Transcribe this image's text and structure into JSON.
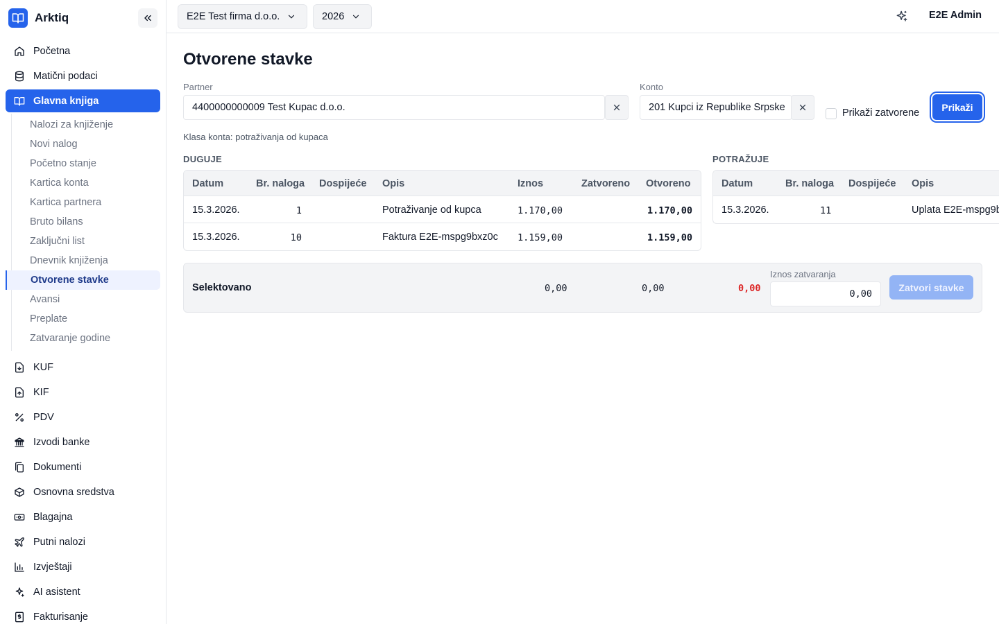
{
  "app": {
    "name": "Arktiq",
    "colors": {
      "accent": "#2563eb",
      "danger": "#dc2626",
      "muted": "#6b7280"
    }
  },
  "topbar": {
    "company": "E2E Test firma d.o.o.",
    "year": "2026",
    "user": "E2E Admin",
    "ai_icon": "sparkle-icon"
  },
  "sidebar": {
    "items_top": [
      {
        "label": "Početna",
        "icon": "home-icon"
      },
      {
        "label": "Matični podaci",
        "icon": "database-icon"
      },
      {
        "label": "Glavna knjiga",
        "icon": "book-icon",
        "active": true
      }
    ],
    "subitems": [
      {
        "label": "Nalozi za knjiženje"
      },
      {
        "label": "Novi nalog"
      },
      {
        "label": "Početno stanje"
      },
      {
        "label": "Kartica konta"
      },
      {
        "label": "Kartica partnera"
      },
      {
        "label": "Bruto bilans"
      },
      {
        "label": "Zaključni list"
      },
      {
        "label": "Dnevnik knjiženja"
      },
      {
        "label": "Otvorene stavke",
        "active": true
      },
      {
        "label": "Avansi"
      },
      {
        "label": "Preplate"
      },
      {
        "label": "Zatvaranje godine"
      }
    ],
    "items_bottom": [
      {
        "label": "KUF",
        "icon": "file-download-icon"
      },
      {
        "label": "KIF",
        "icon": "file-upload-icon"
      },
      {
        "label": "PDV",
        "icon": "percent-icon"
      },
      {
        "label": "Izvodi banke",
        "icon": "bank-icon"
      },
      {
        "label": "Dokumenti",
        "icon": "documents-icon"
      },
      {
        "label": "Osnovna sredstva",
        "icon": "box-icon"
      },
      {
        "label": "Blagajna",
        "icon": "cash-icon"
      },
      {
        "label": "Putni nalozi",
        "icon": "plane-icon"
      },
      {
        "label": "Izvještaji",
        "icon": "bar-chart-icon"
      },
      {
        "label": "AI asistent",
        "icon": "sparkle-icon"
      },
      {
        "label": "Fakturisanje",
        "icon": "invoice-icon"
      }
    ]
  },
  "page": {
    "title": "Otvorene stavke",
    "partner_label": "Partner",
    "partner_value": "4400000000009 Test Kupac d.o.o.",
    "konto_label": "Konto",
    "konto_value": "201 Kupci iz Republike Srpske",
    "show_closed_label": "Prikaži zatvorene",
    "show_button": "Prikaži",
    "hint": "Klasa konta: potraživanja od kupaca"
  },
  "duguje": {
    "title": "DUGUJE",
    "columns": [
      "Datum",
      "Br. naloga",
      "Dospijeće",
      "Opis",
      "Iznos",
      "Zatvoreno",
      "Otvoreno"
    ],
    "rows": [
      {
        "datum": "15.3.2026.",
        "br_naloga": "1",
        "dospijece": "",
        "opis": "Potraživanje od kupca",
        "iznos": "1.170,00",
        "zatvoreno": "",
        "otvoreno": "1.170,00"
      },
      {
        "datum": "15.3.2026.",
        "br_naloga": "10",
        "dospijece": "",
        "opis": "Faktura E2E-mspg9bxz0c",
        "iznos": "1.159,00",
        "zatvoreno": "",
        "otvoreno": "1.159,00"
      }
    ]
  },
  "potrazuje": {
    "title": "POTRAŽUJE",
    "columns": [
      "Datum",
      "Br. naloga",
      "Dospijeće",
      "Opis"
    ],
    "rows": [
      {
        "datum": "15.3.2026.",
        "br_naloga": "11",
        "dospijece": "",
        "opis": "Uplata E2E-mspg9b"
      }
    ]
  },
  "summary": {
    "label": "Selektovano",
    "duguje_sum": "0,00",
    "potrazuje_sum": "0,00",
    "difference": "0,00",
    "close_amount_label": "Iznos zatvaranja",
    "close_amount_value": "0,00",
    "close_button": "Zatvori stavke"
  }
}
